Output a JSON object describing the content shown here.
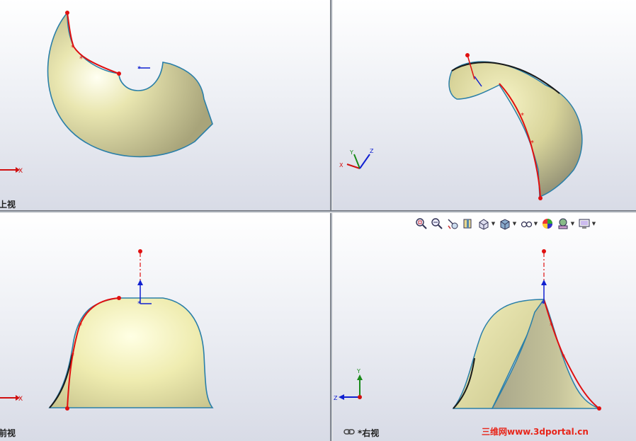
{
  "views": {
    "top_left": {
      "label": "上视",
      "axis_x": "X"
    },
    "top_right": {
      "label": "",
      "axis_x": "X",
      "axis_y": "Y",
      "axis_z": "Z"
    },
    "bottom_left": {
      "label": "前视",
      "axis_x": "X"
    },
    "bottom_right": {
      "label": "*右视",
      "axis_y": "Y",
      "axis_z": "Z"
    }
  },
  "toolbar": {
    "items": [
      "zoom-to-fit-icon",
      "zoom-to-area-icon",
      "previous-view-icon",
      "section-view-icon",
      "view-orientation-icon",
      "display-style-icon",
      "hide-show-items-icon",
      "edit-appearance-icon",
      "apply-scene-icon",
      "view-settings-icon"
    ]
  },
  "watermark": "三维网www.3dportal.cn",
  "colors": {
    "surface": "#e8e6a8",
    "edge": "#2a7fa8",
    "sketch": "#e01010",
    "axis_x": "#d01010",
    "axis_y": "#1a8a1a",
    "axis_z": "#1020d0"
  }
}
